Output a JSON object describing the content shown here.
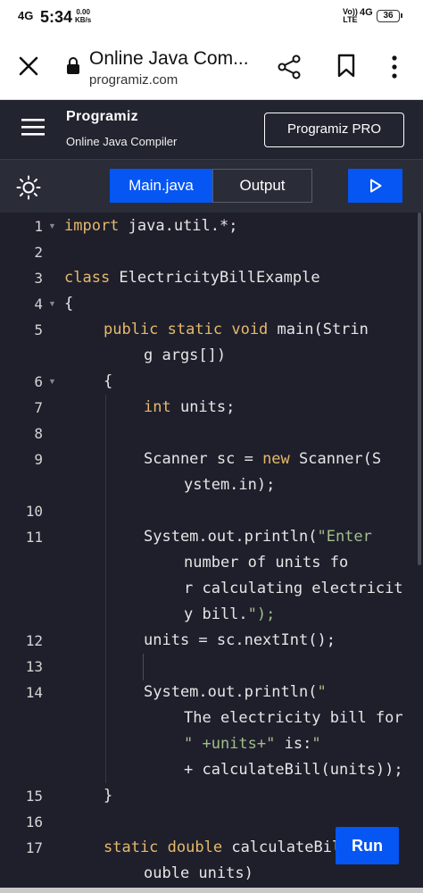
{
  "status_bar": {
    "signal": "4G",
    "time": "5:34",
    "speed_value": "0.00",
    "speed_unit": "KB/s",
    "volte": "Vo))",
    "lte": "LTE",
    "network": "4G",
    "battery": "36"
  },
  "browser": {
    "page_title": "Online Java Com...",
    "url": "programiz.com"
  },
  "site_header": {
    "logo": "Programiz",
    "subtitle": "Online Java Compiler",
    "pro_button": "Programiz PRO"
  },
  "tabs": {
    "main": "Main.java",
    "output": "Output"
  },
  "run_button": "Run",
  "code_lines": [
    {
      "n": "1",
      "fold": true,
      "text": "import java.util.*;"
    },
    {
      "n": "2",
      "text": ""
    },
    {
      "n": "3",
      "text": "class ElectricityBillExample"
    },
    {
      "n": "4",
      "fold": true,
      "text": "{"
    },
    {
      "n": "5",
      "text": "public static void main(String args[])"
    },
    {
      "n": "6",
      "fold": true,
      "text": "{"
    },
    {
      "n": "7",
      "text": "int units;"
    },
    {
      "n": "8",
      "text": ""
    },
    {
      "n": "9",
      "text": "Scanner sc = new Scanner(System.in);"
    },
    {
      "n": "10",
      "text": ""
    },
    {
      "n": "11",
      "text": "System.out.println(\"Enter number of units for calculating electricity bill.\");"
    },
    {
      "n": "12",
      "text": "units = sc.nextInt();"
    },
    {
      "n": "13",
      "text": ""
    },
    {
      "n": "14",
      "text": "System.out.println(\"The electricity bill for \" +units+\" is:\" + calculateBill(units));"
    },
    {
      "n": "15",
      "text": "}"
    },
    {
      "n": "16",
      "text": ""
    },
    {
      "n": "17",
      "text": "static double calculateBill(double units)"
    }
  ]
}
